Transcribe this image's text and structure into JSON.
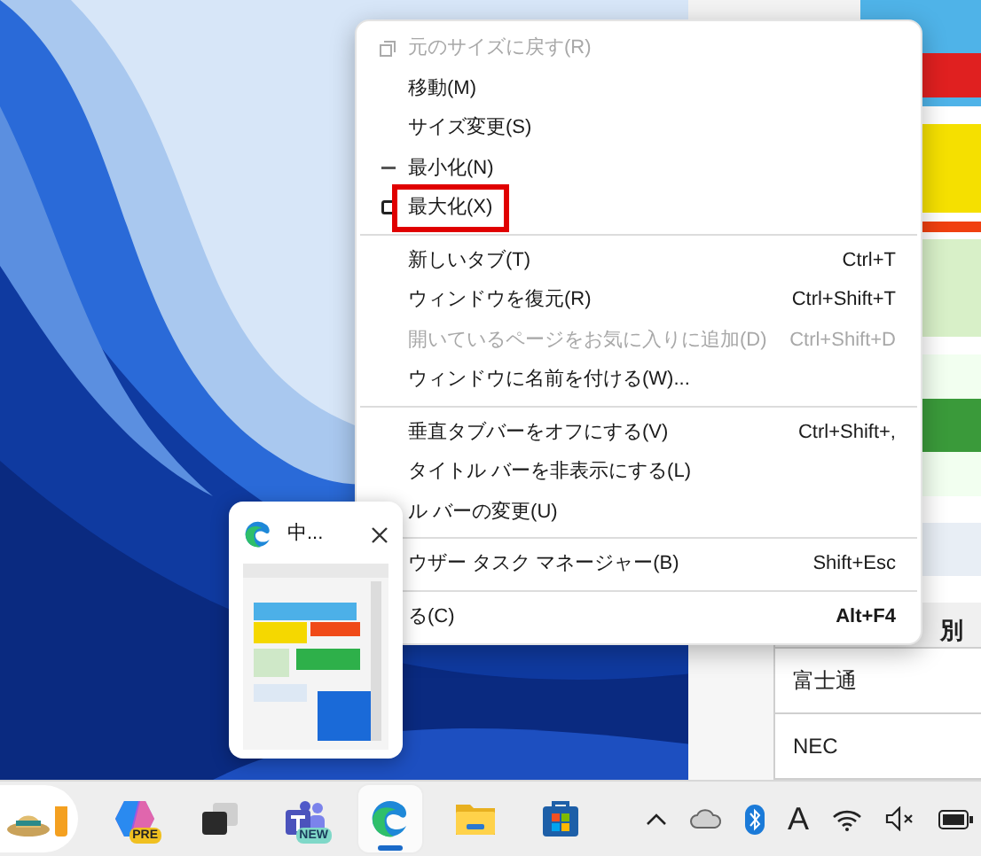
{
  "context_menu": {
    "items": [
      {
        "kind": "restore",
        "label": "元のサイズに戻す(R)",
        "disabled": true,
        "highlighted": false
      },
      {
        "kind": "item",
        "label": "移動(M)",
        "disabled": false,
        "highlighted": false
      },
      {
        "kind": "item",
        "label": "サイズ変更(S)",
        "disabled": false,
        "highlighted": false
      },
      {
        "kind": "minimize",
        "label": "最小化(N)",
        "disabled": false,
        "highlighted": false
      },
      {
        "kind": "maximize",
        "label": "最大化(X)",
        "disabled": false,
        "highlighted": true
      },
      {
        "kind": "separator"
      },
      {
        "kind": "item",
        "label": "新しいタブ(T)",
        "shortcut": "Ctrl+T",
        "disabled": false,
        "highlighted": false
      },
      {
        "kind": "item",
        "label": "ウィンドウを復元(R)",
        "shortcut": "Ctrl+Shift+T",
        "disabled": false,
        "highlighted": false
      },
      {
        "kind": "item",
        "label": "開いているページをお気に入りに追加(D)",
        "shortcut": "Ctrl+Shift+D",
        "disabled": true,
        "highlighted": false
      },
      {
        "kind": "item",
        "label": "ウィンドウに名前を付ける(W)...",
        "disabled": false,
        "highlighted": false
      },
      {
        "kind": "separator"
      },
      {
        "kind": "item",
        "label": "垂直タブバーをオフにする(V)",
        "shortcut": "Ctrl+Shift+,",
        "disabled": false,
        "highlighted": false
      },
      {
        "kind": "item",
        "label": "タイトル バーを非表示にする(L)",
        "disabled": false,
        "highlighted": false
      },
      {
        "kind": "item",
        "label": "ル バーの変更(U)",
        "disabled": false,
        "highlighted": false
      },
      {
        "kind": "separator"
      },
      {
        "kind": "item",
        "label": "ウザー タスク マネージャー(B)",
        "shortcut": "Shift+Esc",
        "disabled": false,
        "highlighted": false
      },
      {
        "kind": "separator"
      },
      {
        "kind": "close",
        "label": "る(C)",
        "shortcut": "Alt+F4",
        "disabled": false,
        "highlighted": false
      }
    ]
  },
  "browser_page": {
    "table": {
      "header": "別",
      "rows": [
        "富士通",
        "NEC"
      ]
    }
  },
  "thumbnail": {
    "title": "中..."
  },
  "taskbar": {
    "apps": [
      {
        "kind": "widgets",
        "selected": false
      },
      {
        "kind": "copilot",
        "badge": "PRE",
        "selected": false
      },
      {
        "kind": "taskview",
        "selected": false
      },
      {
        "kind": "teams",
        "badge": "NEW",
        "selected": false
      },
      {
        "kind": "edge",
        "selected": true
      },
      {
        "kind": "explorer",
        "selected": false
      },
      {
        "kind": "store",
        "selected": false
      }
    ],
    "tray": [
      {
        "kind": "chevron"
      },
      {
        "kind": "cloud"
      },
      {
        "kind": "bluetooth"
      },
      {
        "kind": "ime",
        "label": "A"
      },
      {
        "kind": "wifi"
      },
      {
        "kind": "volume"
      },
      {
        "kind": "battery"
      }
    ]
  }
}
